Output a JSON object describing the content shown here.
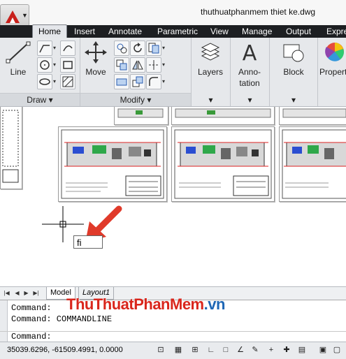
{
  "title": "thuthuatphanmem thiet ke.dwg",
  "tabs": [
    "Home",
    "Insert",
    "Annotate",
    "Parametric",
    "View",
    "Manage",
    "Output",
    "Expre"
  ],
  "panels": {
    "draw": {
      "title": "Draw",
      "line_label": "Line"
    },
    "modify": {
      "title": "Modify",
      "move_label": "Move"
    },
    "layers": {
      "label": "Layers"
    },
    "annotation": {
      "label_line1": "Anno-",
      "label_line2": "tation"
    },
    "block": {
      "label": "Block"
    },
    "properties": {
      "label": "Propert"
    }
  },
  "dynamic_input": {
    "value": "fi"
  },
  "layout_tabs": [
    "Model",
    "Layout1"
  ],
  "command_history": [
    "Command:",
    "Command: COMMANDLINE"
  ],
  "command_prompt": "Command:",
  "coordinates": "35039.6296, -61509.4991, 0.0000",
  "watermark": {
    "part1": "ThuThuat",
    "part2": "PhanMem",
    "part3": ".vn"
  },
  "colors": {
    "accent_red": "#d9261c",
    "ribbon_bg": "#e6e8eb",
    "tabbar_bg": "#1d1f22",
    "watermark_blue": "#1f67b5"
  }
}
